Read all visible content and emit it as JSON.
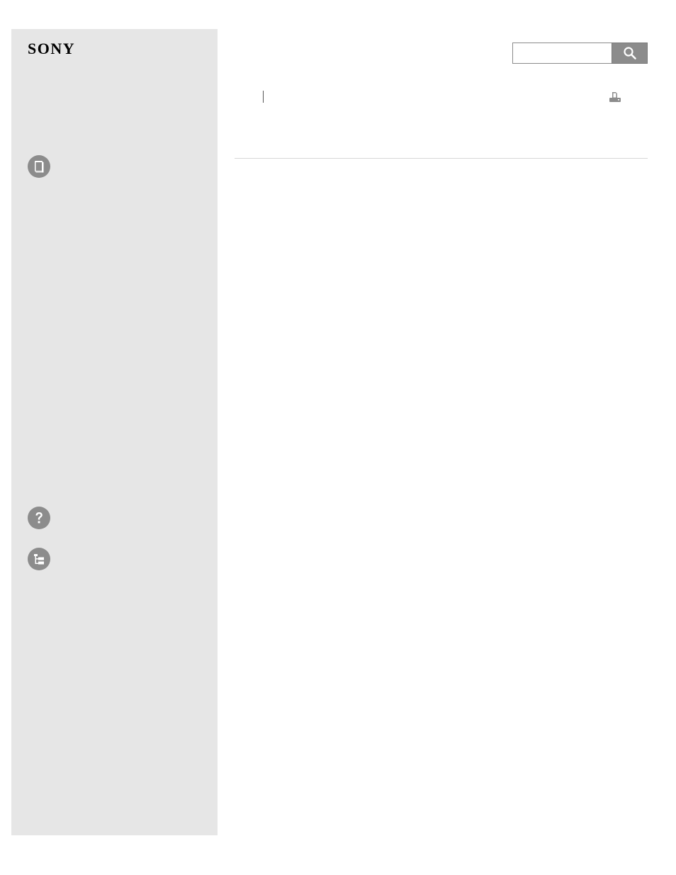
{
  "brand": {
    "logo_text": "SONY"
  },
  "search": {
    "value": "",
    "placeholder": ""
  },
  "icons": {
    "manual": "book-icon",
    "help": "question-icon",
    "tree": "tree-list-icon",
    "search": "search-icon",
    "print": "print-icon"
  },
  "colors": {
    "sidebar_background": "#e6e6e6",
    "icon_gray": "#8c8c8c",
    "divider": "#d6d6d6"
  }
}
